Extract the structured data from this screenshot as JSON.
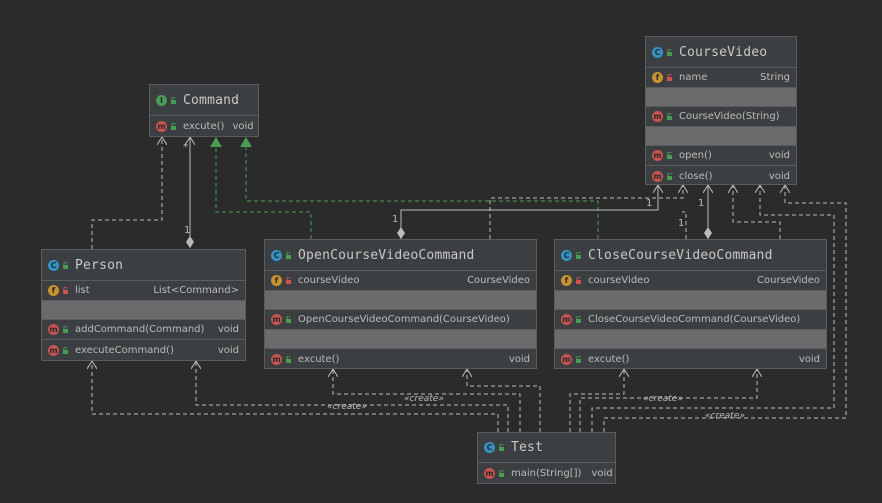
{
  "colors": {
    "background": "#2b2b2b",
    "node_fill": "#3c3f41",
    "node_border": "#5a5d5f",
    "separator_fill": "#6b6b6b",
    "class_badge": "#3592c4",
    "interface_badge": "#499c54",
    "field_badge": "#c7922f",
    "method_badge": "#c75450",
    "public_lock": "#499c54",
    "private_lock": "#d15050",
    "dependency_line": "#bbbbbb",
    "realization_line": "#499c54"
  },
  "badges": {
    "class": "C",
    "interface": "I",
    "field": "f",
    "method": "m"
  },
  "nodes": {
    "command": {
      "name": "Command",
      "kind": "interface",
      "methods": [
        {
          "name": "excute()",
          "type": "void",
          "access": "public"
        }
      ]
    },
    "course_video": {
      "name": "CourseVideo",
      "kind": "class",
      "fields": [
        {
          "name": "name",
          "type": "String",
          "access": "private"
        }
      ],
      "constructors": [
        {
          "name": "CourseVideo(String)",
          "access": "public"
        }
      ],
      "methods": [
        {
          "name": "open()",
          "type": "void",
          "access": "public"
        },
        {
          "name": "close()",
          "type": "void",
          "access": "public"
        }
      ]
    },
    "person": {
      "name": "Person",
      "kind": "class",
      "fields": [
        {
          "name": "list",
          "type": "List<Command>",
          "access": "private"
        }
      ],
      "methods": [
        {
          "name": "addCommand(Command)",
          "type": "void",
          "access": "public"
        },
        {
          "name": "executeCommand()",
          "type": "void",
          "access": "public"
        }
      ]
    },
    "open_cmd": {
      "name": "OpenCourseVideoCommand",
      "kind": "class",
      "fields": [
        {
          "name": "courseVideo",
          "type": "CourseVideo",
          "access": "private"
        }
      ],
      "constructors": [
        {
          "name": "OpenCourseVideoCommand(CourseVideo)",
          "access": "public"
        }
      ],
      "methods": [
        {
          "name": "excute()",
          "type": "void",
          "access": "public"
        }
      ]
    },
    "close_cmd": {
      "name": "CloseCourseVideoCommand",
      "kind": "class",
      "fields": [
        {
          "name": "courseVideo",
          "type": "CourseVideo",
          "access": "private"
        }
      ],
      "constructors": [
        {
          "name": "CloseCourseVideoCommand(CourseVideo)",
          "access": "public"
        }
      ],
      "methods": [
        {
          "name": "excute()",
          "type": "void",
          "access": "public"
        }
      ]
    },
    "test": {
      "name": "Test",
      "kind": "class",
      "methods": [
        {
          "name": "main(String[])",
          "type": "void",
          "access": "public"
        }
      ]
    }
  },
  "edge_labels": {
    "create": "«create»",
    "mult_one": "1",
    "mult_many": "*"
  }
}
